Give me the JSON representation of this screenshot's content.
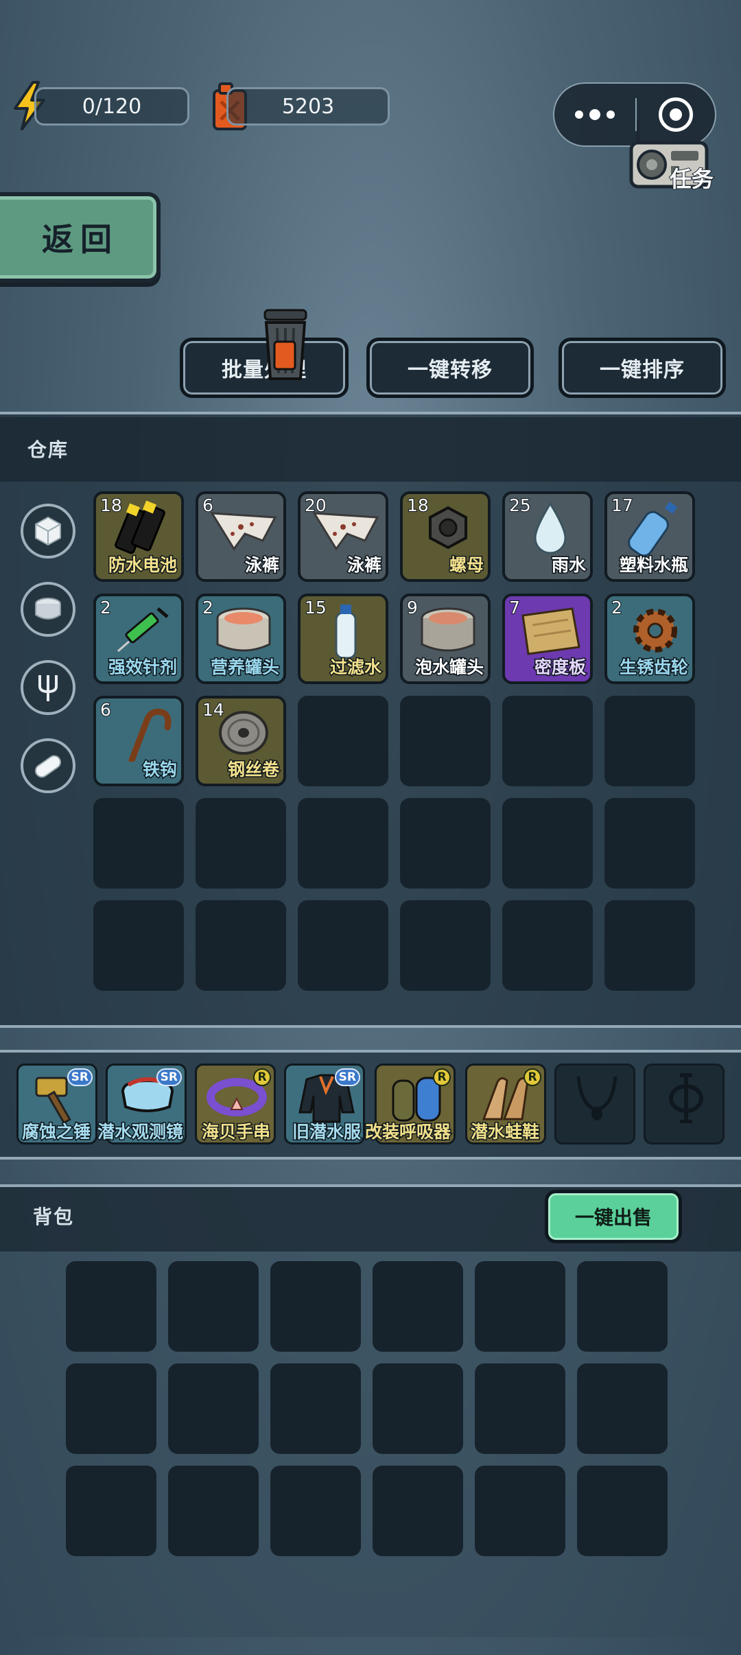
{
  "hud": {
    "energy": "0/120",
    "fuel": "5203",
    "task_label": "任务"
  },
  "back_label": "返回",
  "actions": {
    "batch": "批量处理",
    "transfer": "一键转移",
    "sort": "一键排序"
  },
  "warehouse": {
    "title": "仓库",
    "categories": [
      "cube-icon",
      "can-icon",
      "fork-icon",
      "pill-icon"
    ],
    "items": [
      {
        "count": "18",
        "name": "防水电池",
        "rarity": "olive",
        "icon": "battery-icon"
      },
      {
        "count": "6",
        "name": "泳裤",
        "rarity": "gray",
        "icon": "swim-trunks-icon"
      },
      {
        "count": "20",
        "name": "泳裤",
        "rarity": "gray",
        "icon": "swim-trunks-icon"
      },
      {
        "count": "18",
        "name": "螺母",
        "rarity": "olive",
        "icon": "nut-icon"
      },
      {
        "count": "25",
        "name": "雨水",
        "rarity": "gray",
        "icon": "water-drop-icon"
      },
      {
        "count": "17",
        "name": "塑料水瓶",
        "rarity": "gray",
        "icon": "plastic-bottle-icon"
      },
      {
        "count": "2",
        "name": "强效针剂",
        "rarity": "teal",
        "icon": "syringe-icon"
      },
      {
        "count": "2",
        "name": "营养罐头",
        "rarity": "teal",
        "icon": "canned-fish-icon"
      },
      {
        "count": "15",
        "name": "过滤水",
        "rarity": "olive",
        "icon": "water-bottle-icon"
      },
      {
        "count": "9",
        "name": "泡水罐头",
        "rarity": "gray",
        "icon": "canned-fish-icon"
      },
      {
        "count": "7",
        "name": "密度板",
        "rarity": "purple",
        "icon": "board-icon"
      },
      {
        "count": "2",
        "name": "生锈齿轮",
        "rarity": "teal",
        "icon": "gear-icon"
      },
      {
        "count": "6",
        "name": "铁钩",
        "rarity": "teal",
        "icon": "hook-icon"
      },
      {
        "count": "14",
        "name": "钢丝卷",
        "rarity": "olive",
        "icon": "wire-spool-icon"
      }
    ]
  },
  "equipment": [
    {
      "name": "腐蚀之锤",
      "grade": "SR",
      "icon": "hammer-icon"
    },
    {
      "name": "潜水观测镜",
      "grade": "SR",
      "icon": "dive-mask-icon"
    },
    {
      "name": "海贝手串",
      "grade": "R",
      "icon": "bracelet-icon"
    },
    {
      "name": "旧潜水服",
      "grade": "SR",
      "icon": "wetsuit-icon"
    },
    {
      "name": "改装呼吸器",
      "grade": "R",
      "icon": "rebreather-icon"
    },
    {
      "name": "潜水蛙鞋",
      "grade": "R",
      "icon": "flippers-icon"
    }
  ],
  "backpack": {
    "title": "背包",
    "sell_label": "一键出售"
  },
  "colors": {
    "accent_green": "#5bd09a",
    "slot_bg": "#17232c"
  }
}
